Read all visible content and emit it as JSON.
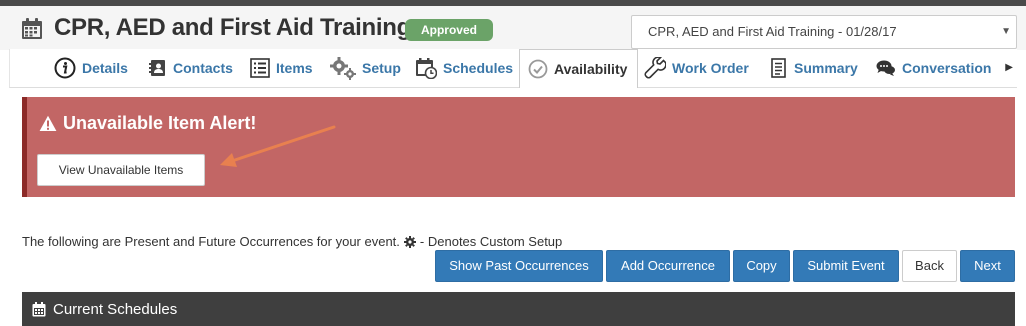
{
  "header": {
    "title": "CPR, AED and First Aid Training",
    "status_badge": "Approved",
    "event_select_value": "CPR, AED and First Aid Training - 01/28/17"
  },
  "tabs": [
    {
      "label": "Details",
      "icon": "info-icon"
    },
    {
      "label": "Contacts",
      "icon": "address-book-icon"
    },
    {
      "label": "Items",
      "icon": "list-icon"
    },
    {
      "label": "Setup",
      "icon": "gears-icon"
    },
    {
      "label": "Schedules",
      "icon": "calendar-clock-icon"
    },
    {
      "label": "Availability",
      "icon": "check-circle-icon",
      "active": true
    },
    {
      "label": "Work Order",
      "icon": "wrench-icon"
    },
    {
      "label": "Summary",
      "icon": "document-icon"
    },
    {
      "label": "Conversation",
      "icon": "chat-icon"
    }
  ],
  "alert": {
    "title": "Unavailable Item Alert!",
    "button_label": "View Unavailable Items"
  },
  "info": {
    "text": "The following are Present and Future Occurrences for your event.",
    "legend": "- Denotes Custom Setup"
  },
  "actions": {
    "show_past": "Show Past Occurrences",
    "add_occurrence": "Add Occurrence",
    "copy": "Copy",
    "submit_event": "Submit Event",
    "back": "Back",
    "next": "Next"
  },
  "panel": {
    "title": "Current Schedules"
  },
  "colors": {
    "alert_bg": "#c26665",
    "alert_border": "#8c2a28",
    "primary_button": "#337ab7",
    "status_badge": "#6ba368",
    "tab_link": "#3b77a8",
    "annotation_arrow": "#e8804f"
  }
}
